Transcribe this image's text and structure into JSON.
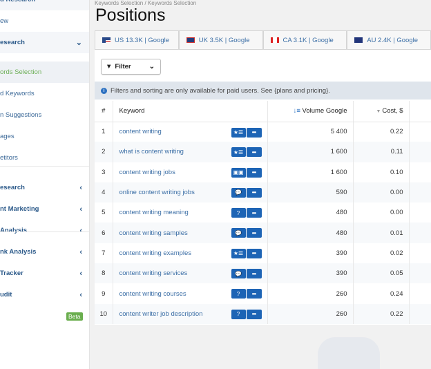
{
  "sidebar": {
    "items": [
      {
        "label": "d Research",
        "group": true
      },
      {
        "label": "ew"
      },
      {
        "label": "esearch",
        "group": true,
        "chev": "⌄"
      },
      {
        "label": "ords Selection",
        "active": true
      },
      {
        "label": "d Keywords"
      },
      {
        "label": "n Suggestions"
      },
      {
        "label": "ages"
      },
      {
        "label": "etitors"
      },
      {
        "label": "esearch",
        "group": true,
        "chev": "‹"
      },
      {
        "label": "nt Marketing",
        "group": true,
        "chev": "‹"
      },
      {
        "label": "Analysis",
        "group": true,
        "chev": "‹"
      },
      {
        "label": "nk Analysis",
        "group": true,
        "chev": "‹"
      },
      {
        "label": "Tracker",
        "group": true,
        "chev": "‹"
      },
      {
        "label": "udit",
        "group": true,
        "chev": "‹"
      }
    ],
    "beta": "Beta"
  },
  "breadcrumb": "Keywords Selection / Keywords Selection",
  "title": "Positions",
  "tabs": [
    {
      "label": "US 13.3K | Google"
    },
    {
      "label": "UK 3.5K | Google"
    },
    {
      "label": "CA 3.1K | Google"
    },
    {
      "label": "AU 2.4K | Google"
    }
  ],
  "filter": {
    "label": "Filter"
  },
  "info": "Filters and sorting are only available for paid users. See {plans and pricing}.",
  "table": {
    "headers": [
      "#",
      "Keyword",
      "Volume Google",
      "Cost, $"
    ],
    "rows": [
      {
        "n": "1",
        "kw": "content writing",
        "icon": "★☰",
        "vol": "5 400",
        "cost": "0.22"
      },
      {
        "n": "2",
        "kw": "what is content writing",
        "icon": "★☰",
        "vol": "1 600",
        "cost": "0.11"
      },
      {
        "n": "3",
        "kw": "content writing jobs",
        "icon": "▣▣",
        "vol": "1 600",
        "cost": "0.10"
      },
      {
        "n": "4",
        "kw": "online content writing jobs",
        "icon": "💬",
        "vol": "590",
        "cost": "0.00"
      },
      {
        "n": "5",
        "kw": "content writing meaning",
        "icon": "?",
        "vol": "480",
        "cost": "0.00"
      },
      {
        "n": "6",
        "kw": "content writing samples",
        "icon": "💬",
        "vol": "480",
        "cost": "0.01"
      },
      {
        "n": "7",
        "kw": "content writing examples",
        "icon": "★☰",
        "vol": "390",
        "cost": "0.02"
      },
      {
        "n": "8",
        "kw": "content writing services",
        "icon": "💬",
        "vol": "390",
        "cost": "0.05"
      },
      {
        "n": "9",
        "kw": "content writing courses",
        "icon": "?",
        "vol": "260",
        "cost": "0.24"
      },
      {
        "n": "10",
        "kw": "content writer job description",
        "icon": "?",
        "vol": "260",
        "cost": "0.22"
      }
    ]
  }
}
